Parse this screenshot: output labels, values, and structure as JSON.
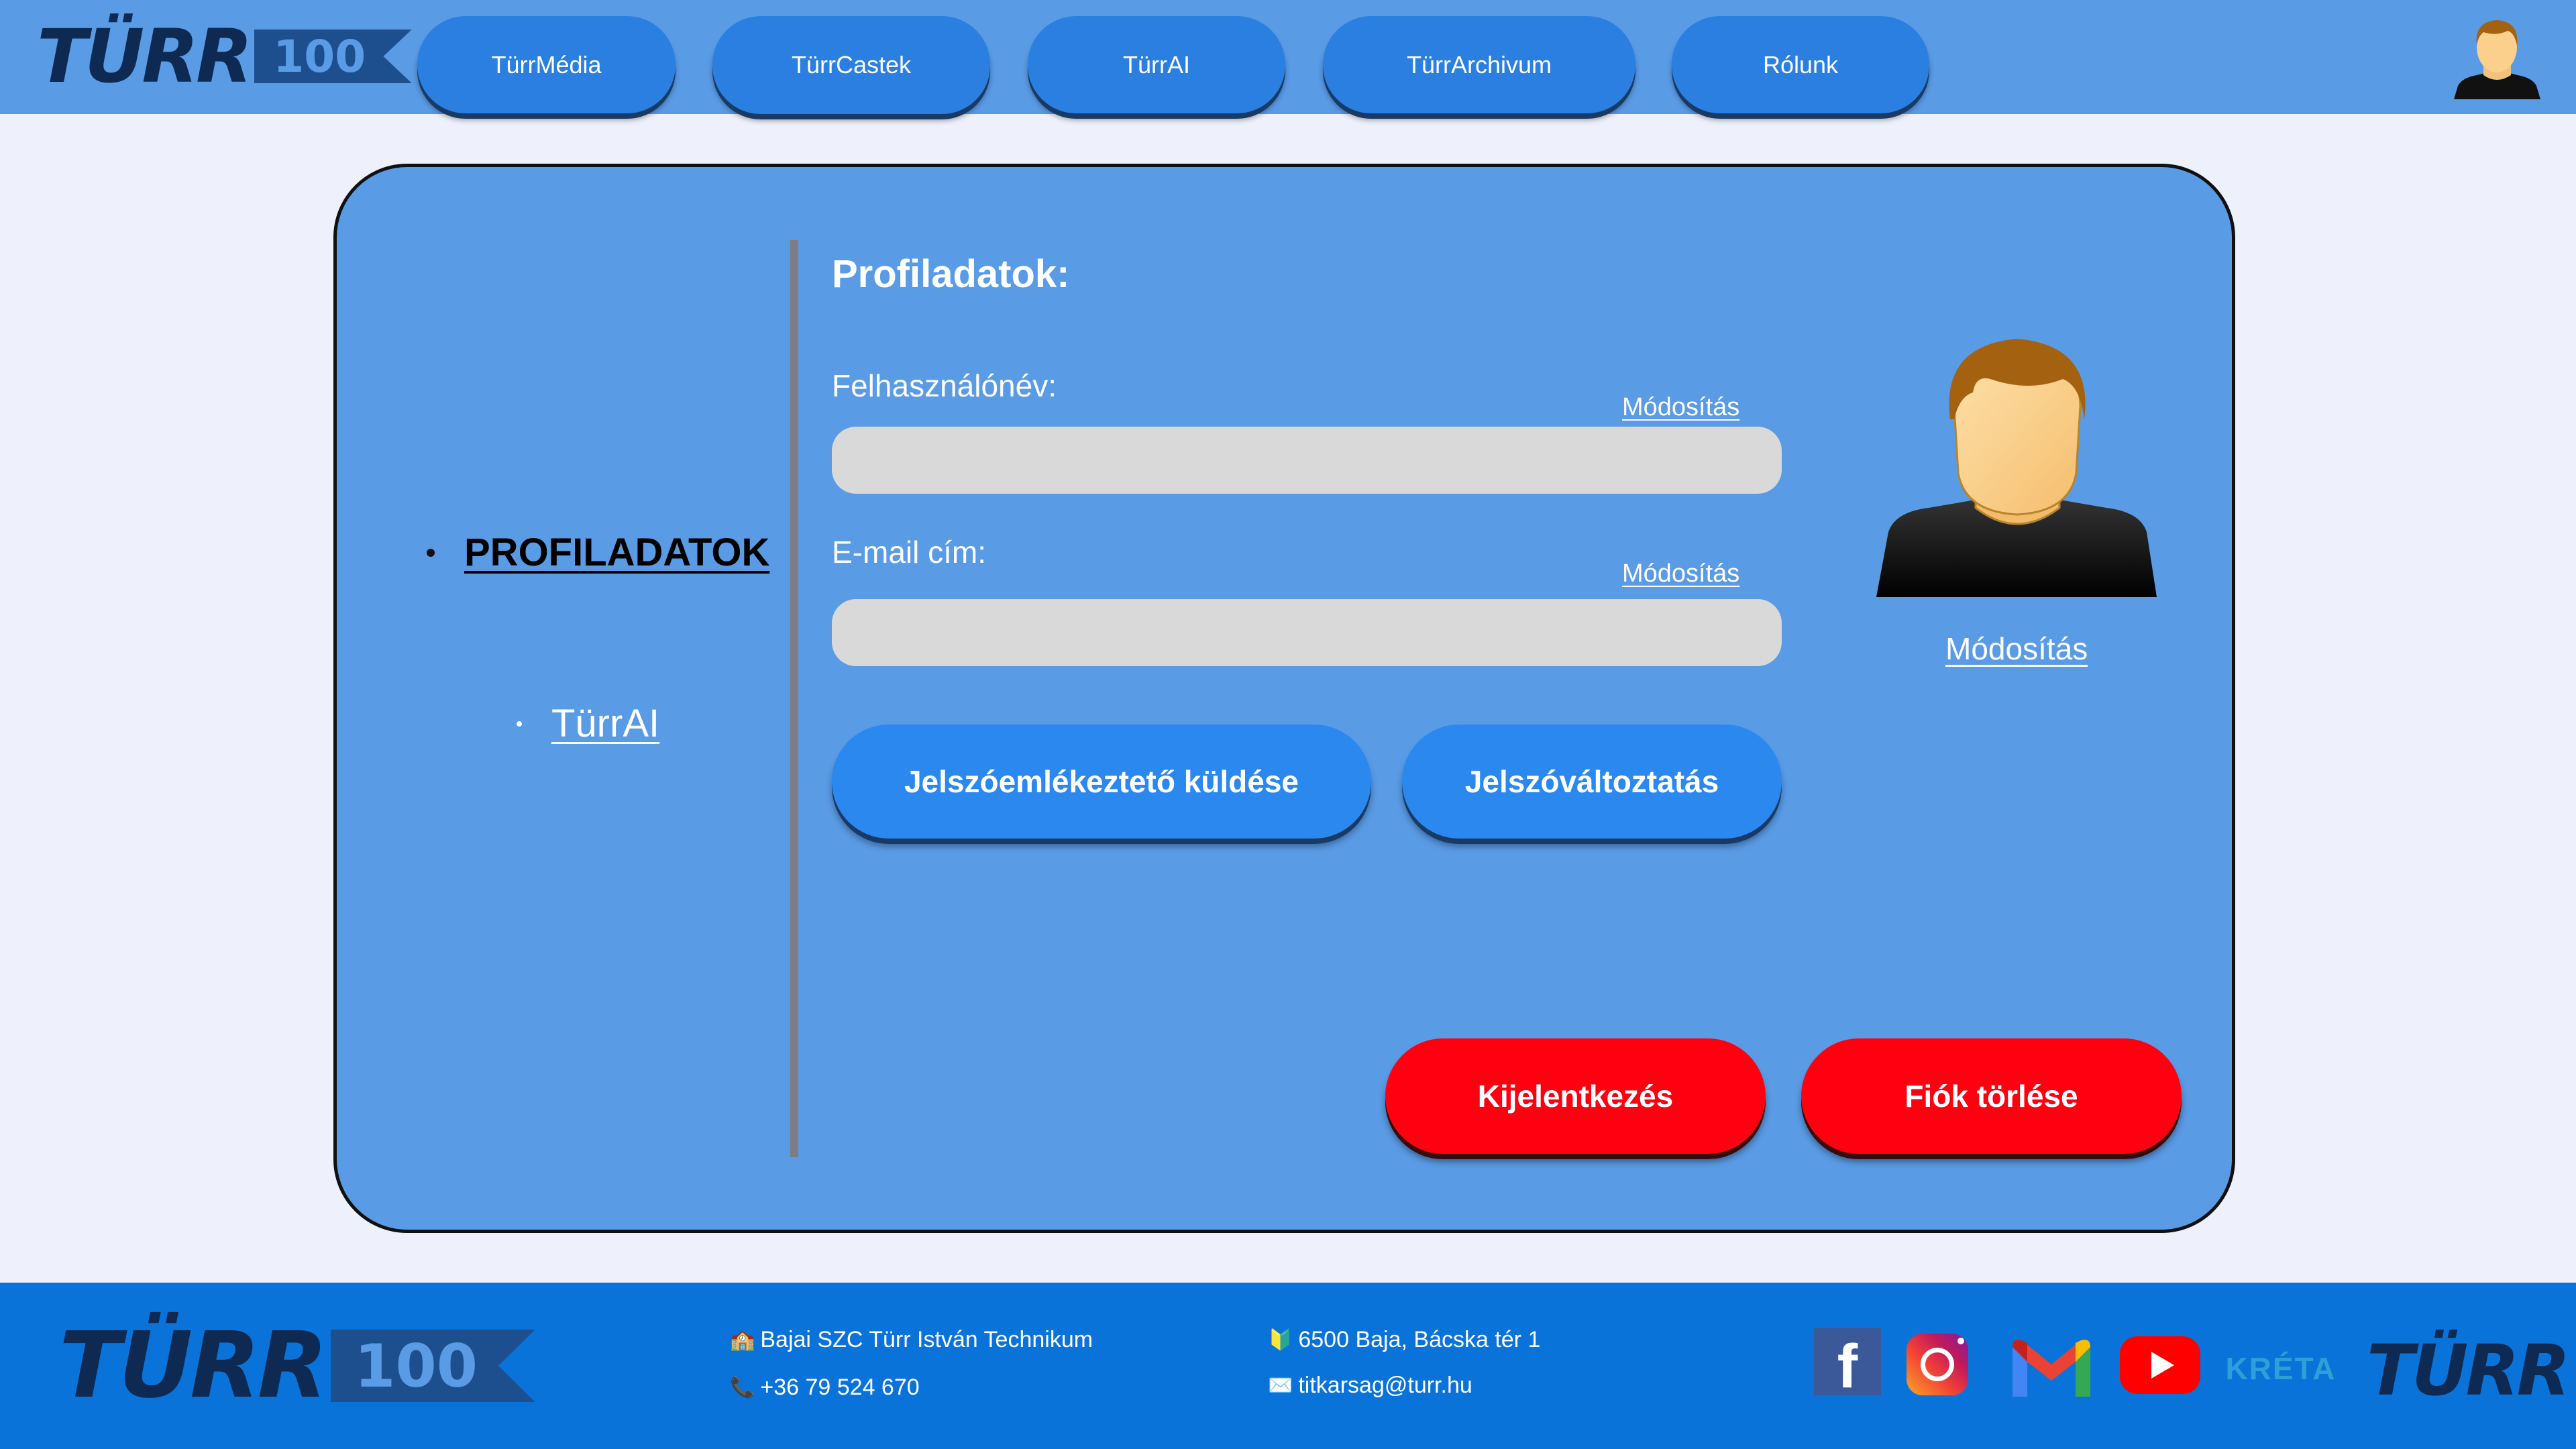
{
  "header": {
    "logo": {
      "word": "TÜRR",
      "number": "100"
    },
    "nav": [
      {
        "label": "TürrMédia"
      },
      {
        "label": "TürrCastek"
      },
      {
        "label": "TürrAI"
      },
      {
        "label": "TürrArchivum"
      },
      {
        "label": "Rólunk"
      }
    ],
    "avatar_icon": "user-avatar-icon"
  },
  "sidebar": {
    "items": [
      {
        "label": "PROFILADATOK",
        "active": true
      },
      {
        "label": "TürrAI",
        "active": false
      }
    ]
  },
  "profile": {
    "title": "Profiladatok:",
    "username": {
      "label": "Felhasználónév:",
      "edit": "Módosítás",
      "value": ""
    },
    "email": {
      "label": "E-mail cím:",
      "edit": "Módosítás",
      "value": ""
    },
    "send_reminder": "Jelszóemlékeztető küldése",
    "change_password": "Jelszóváltoztatás",
    "avatar_edit": "Módosítás",
    "logout": "Kijelentkezés",
    "delete_account": "Fiók törlése"
  },
  "footer": {
    "logo": {
      "word": "TÜRR",
      "number": "100"
    },
    "school": {
      "icon": "🏫",
      "text": "Bajai SZC Türr István Technikum"
    },
    "phone": {
      "icon": "📞",
      "text": "+36 79 524 670"
    },
    "address": {
      "icon": "🔰",
      "text": "6500 Baja, Bácska tér 1"
    },
    "email": {
      "icon": "✉️",
      "text": "titkarsag@turr.hu"
    },
    "social": {
      "facebook": "f",
      "kreta": "KRÉTA",
      "turr_logo": "TÜRR"
    }
  },
  "colors": {
    "header_bg": "#5a9be6",
    "page_bg": "#eef1fb",
    "card_bg": "#5a9be6",
    "nav_button": "#2a7fe0",
    "primary_button": "#2a88ef",
    "danger_button": "#ff0011",
    "input_bg": "#d9d9d9",
    "footer_bg": "#0a73d9",
    "logo_dark": "#0e2a52"
  }
}
